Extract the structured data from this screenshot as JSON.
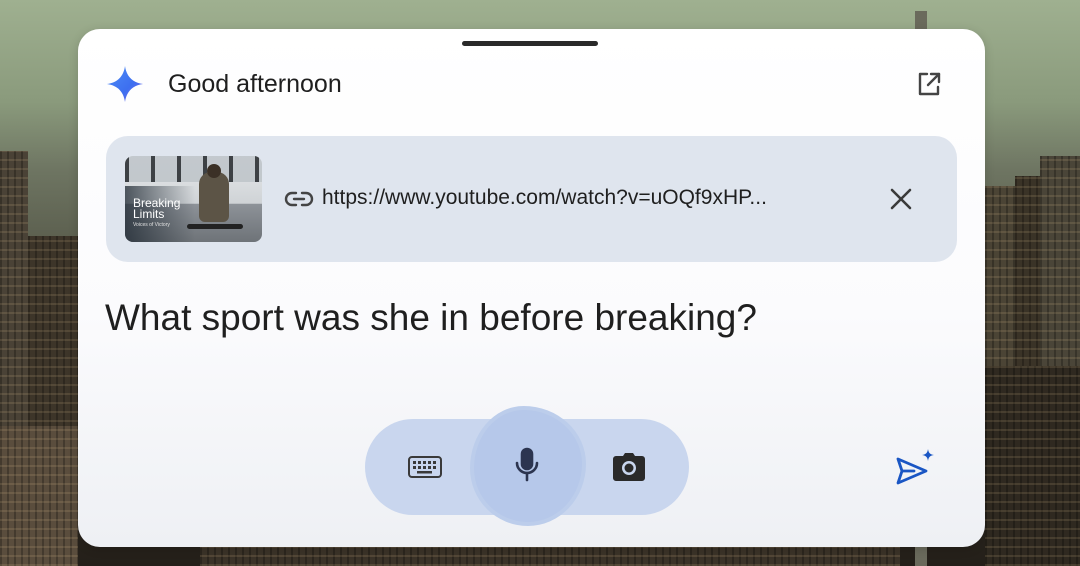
{
  "header": {
    "greeting": "Good afternoon",
    "logo_icon": "gemini-spark-icon",
    "open_icon": "open-in-new-icon"
  },
  "attachment": {
    "thumbnail_title": "Breaking Limits",
    "thumbnail_subtitle": "Voices of Victory",
    "url": "https://www.youtube.com/watch?v=uOQf9xHP...",
    "link_icon": "link-icon",
    "remove_icon": "close-icon"
  },
  "prompt": {
    "text": "What sport was she in before breaking?"
  },
  "input_bar": {
    "buttons": [
      "keyboard-icon",
      "microphone-icon",
      "camera-icon"
    ],
    "active": "microphone-icon"
  },
  "send": {
    "icon": "send-sparkle-icon"
  },
  "colors": {
    "accent": "#1a56c4",
    "input_bar": "#c9d6ee",
    "attachment_bg": "#dfe5ee"
  }
}
